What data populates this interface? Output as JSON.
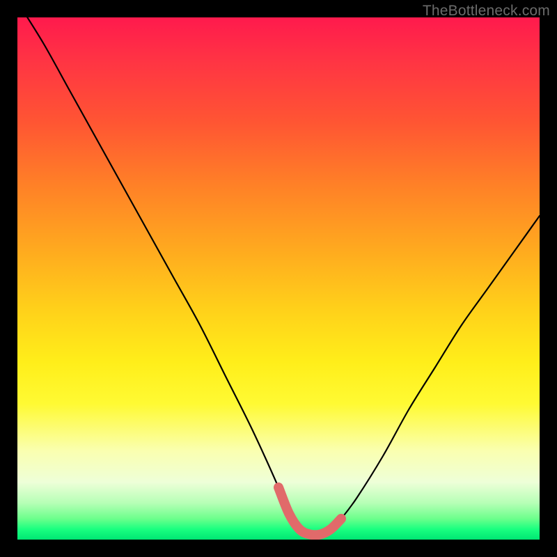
{
  "watermark": "TheBottleneck.com",
  "chart_data": {
    "type": "line",
    "title": "",
    "xlabel": "",
    "ylabel": "",
    "xlim": [
      0,
      100
    ],
    "ylim": [
      0,
      100
    ],
    "series": [
      {
        "name": "bottleneck-curve",
        "x": [
          0,
          5,
          10,
          15,
          20,
          25,
          30,
          35,
          40,
          45,
          50,
          52,
          54,
          56,
          58,
          60,
          62,
          65,
          70,
          75,
          80,
          85,
          90,
          95,
          100
        ],
        "values": [
          103,
          95,
          86,
          77,
          68,
          59,
          50,
          41,
          31,
          21,
          10,
          5,
          2,
          1,
          1,
          2,
          4,
          8,
          16,
          25,
          33,
          41,
          48,
          55,
          62
        ]
      }
    ],
    "highlight": {
      "name": "trough-marker",
      "color": "#e16a6a",
      "x_range": [
        50,
        63
      ],
      "y_level": 2
    },
    "gradient_stops": [
      {
        "pos": 0.0,
        "color": "#ff1a4d"
      },
      {
        "pos": 0.5,
        "color": "#ffd11a"
      },
      {
        "pos": 0.9,
        "color": "#d8ffd8"
      },
      {
        "pos": 1.0,
        "color": "#00e673"
      }
    ]
  }
}
